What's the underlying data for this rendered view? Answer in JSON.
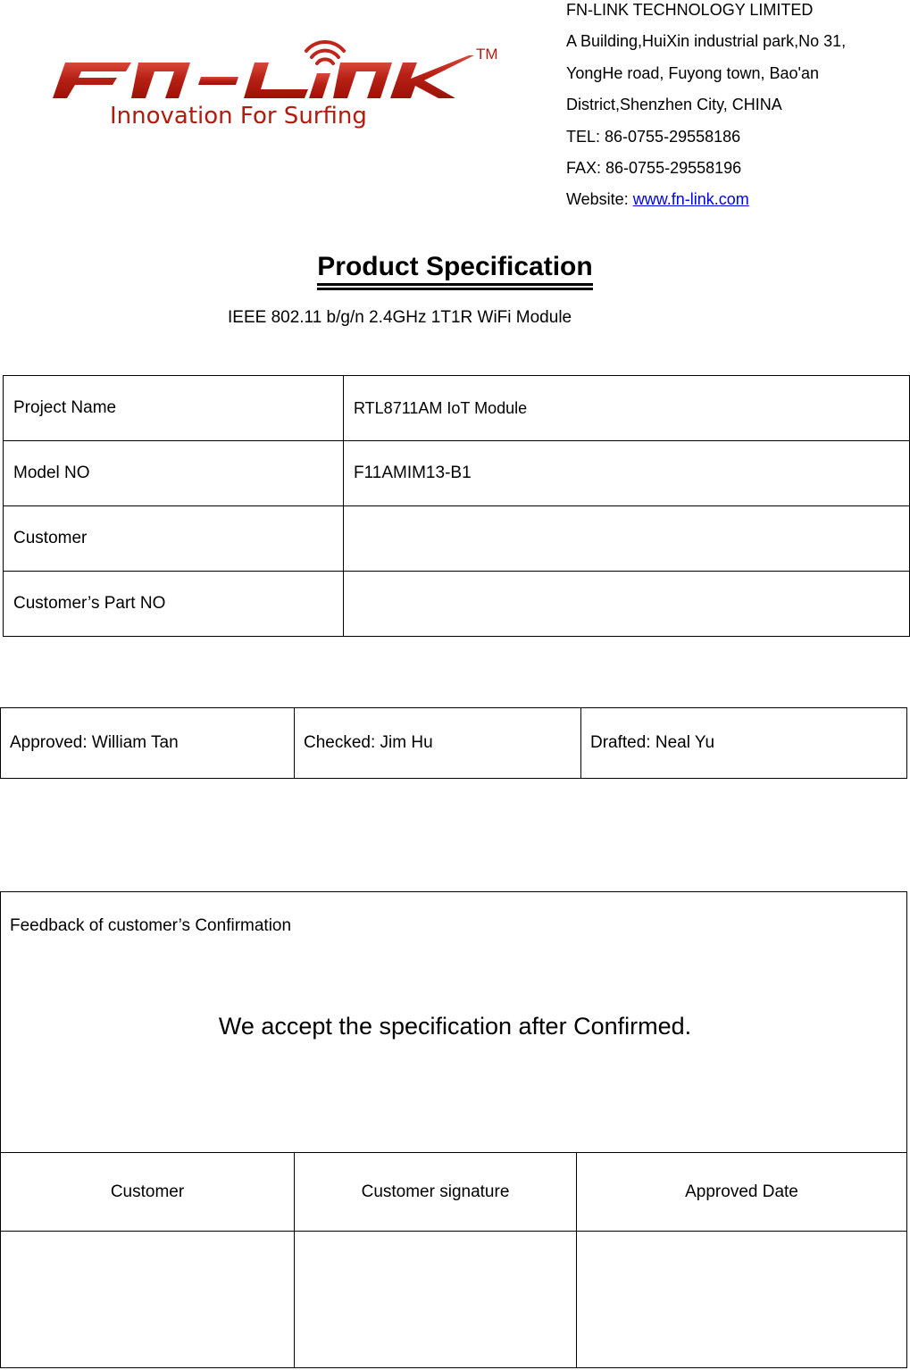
{
  "logo": {
    "wordmark": "FN-LINK",
    "trademark": "TM",
    "tagline": "Innovation For Surfing",
    "brand_color": "#b01c10",
    "icon": "wifi-signal-icon"
  },
  "company": {
    "name": "FN-LINK TECHNOLOGY LIMITED",
    "address_lines": [
      "A Building,HuiXin industrial park,No 31,",
      "YongHe road, Fuyong town, Bao'an",
      "District,Shenzhen  City, CHINA"
    ],
    "tel": "TEL: 86-0755-29558186",
    "fax": "FAX: 86-0755-29558196",
    "website_label": "Website: ",
    "website": "www.fn-link.com",
    "link_color": "#0000ee"
  },
  "title": "Product Specification",
  "subtitle": "IEEE 802.11 b/g/n 2.4GHz 1T1R WiFi Module",
  "info_table": [
    {
      "label": "Project Name",
      "value": "RTL8711AM IoT Module"
    },
    {
      "label": "Model NO",
      "value": "F11AMIM13-B1"
    },
    {
      "label": "Customer",
      "value": ""
    },
    {
      "label": "Customer’s Part NO",
      "value": ""
    }
  ],
  "approval": {
    "approved": "Approved: William Tan",
    "checked": "Checked: Jim Hu",
    "drafted": "Drafted: Neal Yu"
  },
  "feedback": {
    "label": "Feedback of customer’s Confirmation",
    "statement": "We accept the specification after Confirmed.",
    "columns": [
      "Customer",
      "Customer signature",
      "Approved Date"
    ],
    "values": [
      "",
      "",
      ""
    ]
  }
}
